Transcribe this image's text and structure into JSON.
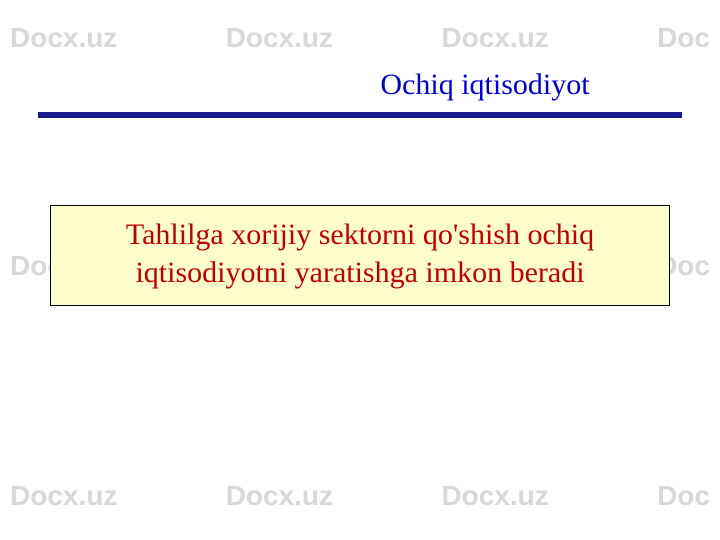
{
  "watermark": {
    "text": "Docx.uz",
    "partial": "Doc"
  },
  "slide": {
    "title": "Ochiq iqtisodiyot",
    "callout": "Tahlilga xorijiy sektorni qo'shish ochiq iqtisodiyotni yaratishga imkon beradi"
  }
}
